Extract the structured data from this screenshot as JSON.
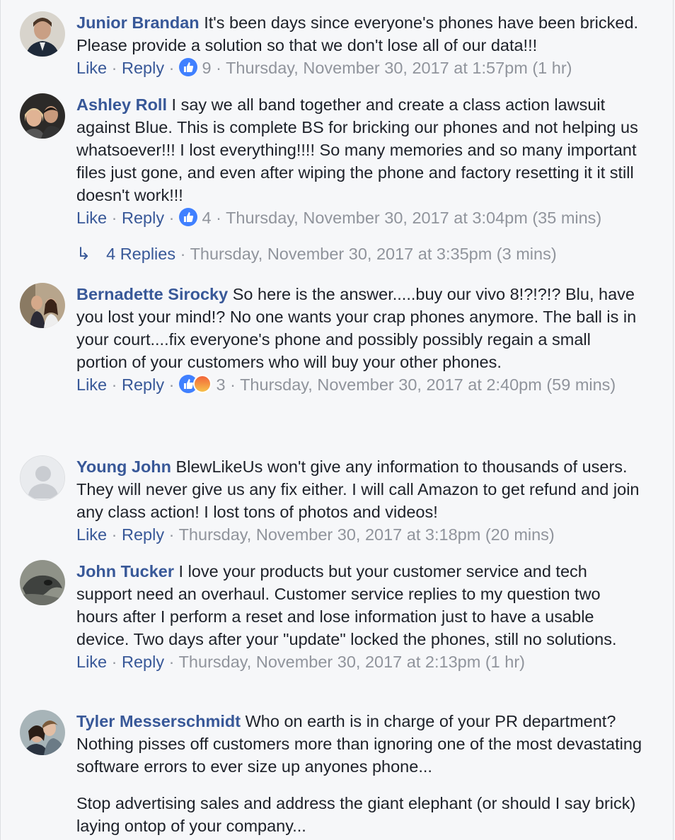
{
  "actions": {
    "like": "Like",
    "reply": "Reply",
    "dot": "·"
  },
  "comments": [
    {
      "name": "Junior Brandan",
      "text": "It's been days since everyone's phones have been bricked. Please provide a solution so that we don't lose all of our data!!!",
      "reactions": "9",
      "timestamp": "Thursday, November 30, 2017 at 1:57pm (1 hr)"
    },
    {
      "name": "Ashley Roll",
      "text": "I say we all band together and create a class action lawsuit against Blue. This is complete BS for bricking our phones and not helping us whatsoever!!! I lost everything!!!! So many memories and so many important files just gone, and even after wiping the phone and factory resetting it it still doesn't work!!!",
      "reactions": "4",
      "timestamp": "Thursday, November 30, 2017 at 3:04pm (35 mins)",
      "replies": {
        "label": "4 Replies",
        "timestamp": "Thursday, November 30, 2017 at 3:35pm (3 mins)"
      }
    },
    {
      "name": "Bernadette Sirocky",
      "text": "So here is the answer.....buy our vivo 8!?!?!? Blu, have you lost your mind!? No one wants your crap phones anymore. The ball is in your court....fix everyone's phone and possibly possibly regain a small portion of your customers who will buy your other phones.",
      "reactions": "3",
      "timestamp": "Thursday, November 30, 2017 at 2:40pm (59 mins)"
    },
    {
      "name": "Young John",
      "text": "BlewLikeUs won't give any information to thousands of users. They will never give us any fix either. I will call Amazon to get refund and join any class action! I lost tons of photos and videos!",
      "timestamp": "Thursday, November 30, 2017 at 3:18pm (20 mins)"
    },
    {
      "name": "John Tucker",
      "text": "I love your products but your customer service and tech support need an overhaul. Customer service replies to my question two hours after I perform a reset and lose information just to have a usable device. Two days after your \"update\" locked the phones, still no solutions.",
      "timestamp": "Thursday, November 30, 2017 at 2:13pm (1 hr)"
    },
    {
      "name": "Tyler Messerschmidt",
      "text": "Who on earth is in charge of your PR department? Nothing pisses off customers more than ignoring one of the most devastating software errors to ever size up anyones phone...",
      "text2": "Stop advertising sales and address the giant elephant (or should I say brick) laying ontop of your company..."
    }
  ],
  "colors": {
    "link": "#385898",
    "meta": "#90949c",
    "like": "#4080ff",
    "background": "#f6f7f9"
  }
}
